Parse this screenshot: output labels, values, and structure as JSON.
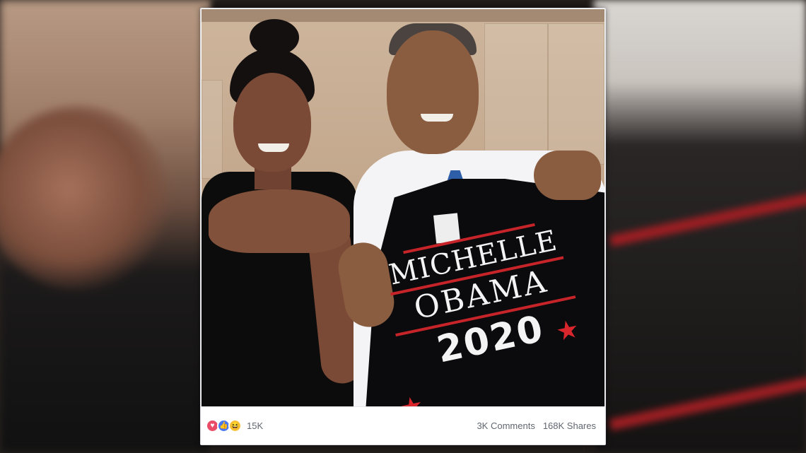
{
  "post": {
    "shirt_text": {
      "line1": "MICHELLE",
      "line2": "OBAMA",
      "year": "2020"
    },
    "reactions": {
      "icons": [
        "love-icon",
        "like-icon",
        "haha-icon"
      ],
      "icon_glyphs": {
        "love": "♥",
        "like": "👍",
        "haha": "😆"
      },
      "count": "15K"
    },
    "comments": "3K Comments",
    "shares": "168K Shares"
  },
  "colors": {
    "love": "#ea4c67",
    "like": "#4a78f0",
    "haha": "#f8c43d",
    "shirt_red": "#c7242a",
    "meta_text": "#616770"
  }
}
